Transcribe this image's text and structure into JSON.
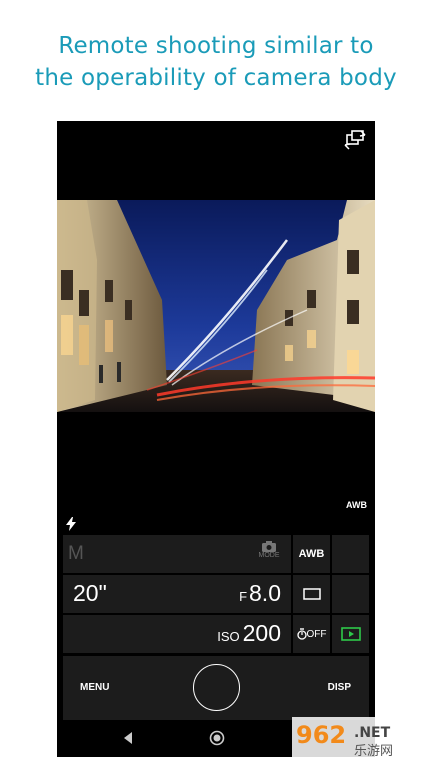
{
  "headline": {
    "line1": "Remote shooting similar to",
    "line2": "the operability of camera body"
  },
  "camera": {
    "awb_indicator": "AWB",
    "mode_letter": "M",
    "mode_label": "MODE",
    "shutter_speed": "20\"",
    "aperture_prefix": "F",
    "aperture_value": "8.0",
    "iso_prefix": "ISO",
    "iso_value": "200",
    "awb_button": "AWB",
    "self_timer": "OFF"
  },
  "bottom_bar": {
    "menu_label": "MENU",
    "disp_label": "DISP"
  },
  "watermark": {
    "text_962": "962",
    "text_net": ".NET",
    "text_cn": "乐游网"
  },
  "colors": {
    "headline": "#1a9bb8",
    "playback_accent": "#2ec84a",
    "panel_cell": "#1c1c1c"
  },
  "icons": [
    "camera-swap-icon",
    "flash-icon",
    "camera-mode-icon",
    "single-drive-icon",
    "self-timer-icon",
    "playback-icon",
    "nav-back-icon",
    "nav-home-icon"
  ]
}
